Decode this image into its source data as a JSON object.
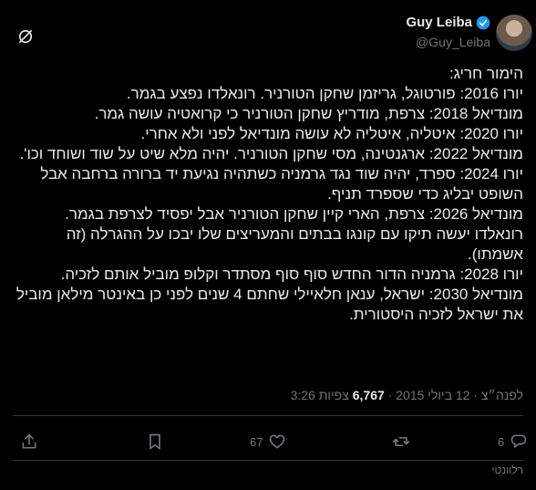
{
  "author": {
    "name": "Guy Leiba",
    "handle": "@Guy_Leiba"
  },
  "icons": {
    "grok": "grok-icon",
    "verified": "verified-badge-icon",
    "share": "share-icon",
    "bookmark": "bookmark-icon",
    "like": "heart-icon",
    "retweet": "retweet-icon",
    "reply": "reply-icon"
  },
  "tweet": {
    "lines": [
      "הימור חריג:",
      "יורו 2016: פורטוגל, גריזמן שחקן הטורניר. רונאלדו נפצע בגמר.",
      "מונדיאל 2018: צרפת, מודריץ שחקן הטורניר כי קרואטיה עושה גמר.",
      "יורו 2020: איטליה, איטליה לא עושה מונדיאל לפני ולא אחרי.",
      "מונדיאל 2022: ארגנטינה, מסי שחקן הטורניר. יהיה מלא שיט על שוד ושוחד וכו'.",
      "יורו 2024: ספרד, יהיה שוד נגד גרמניה כשתהיה נגיעת יד ברורה ברחבה אבל השופט יבליג כדי שספרד תניף.",
      "מונדיאל 2026: צרפת, הארי קיין שחקן הטורניר אבל יפסיד לצרפת בגמר. רונאלדו יעשה תיקו עם קונגו בבתים והמעריצים שלו יבכו על ההגרלה (זה אשמתו).",
      "יורו 2028: גרמניה הדור החדש סוף סוף מסתדר וקלופ מוביל אותם לזכיה.",
      "מונדיאל 2030: ישראל, ענאן חלאיילי שחתם 4 שנים לפני כן באינטר מילאן מוביל את ישראל לזכיה היסטורית."
    ],
    "time": "3:26 לפנה״צ",
    "separator": "·",
    "date": "12 ביולי 2015",
    "views_count": "6,767",
    "views_label": "צפיות"
  },
  "actions": {
    "reply_count": "6",
    "retweet_count": "",
    "like_count": "67"
  },
  "footer": {
    "relevant_label": "רלוונטי"
  },
  "colors": {
    "background": "#000000",
    "text": "#e7e9ea",
    "muted": "#71767b",
    "verified": "#1d9bf0",
    "divider": "#2f3336"
  }
}
